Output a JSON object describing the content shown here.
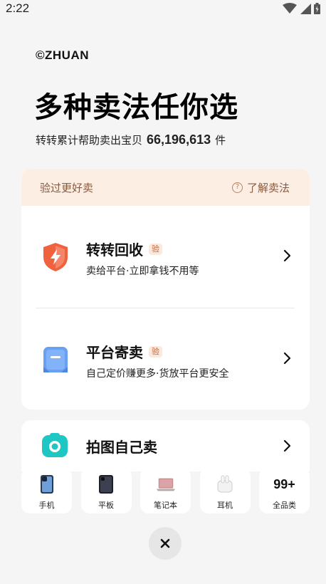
{
  "status_bar": {
    "time": "2:22",
    "icons": [
      "wifi-icon",
      "signal-icon",
      "battery-icon"
    ]
  },
  "brand": "©ZHUAN",
  "headline": "多种卖法任你选",
  "subline": {
    "prefix": "转转累计帮助卖出宝贝",
    "count": "66,196,613",
    "suffix": "件"
  },
  "card_header": {
    "left": "验过更好卖",
    "right": "了解卖法",
    "right_icon": "question-circle-icon"
  },
  "options": [
    {
      "title": "转转回收",
      "badge": "验",
      "desc": "卖给平台·立即拿钱不用等",
      "icon": "shield-lightning-icon"
    },
    {
      "title": "平台寄卖",
      "badge": "验",
      "desc": "自己定价赚更多·货放平台更安全",
      "icon": "box-icon"
    }
  ],
  "photo_sell": {
    "title": "拍图自己卖",
    "icon": "camera-icon"
  },
  "categories": [
    {
      "label": "手机",
      "icon": "phone-icon"
    },
    {
      "label": "平板",
      "icon": "tablet-icon"
    },
    {
      "label": "笔记本",
      "icon": "laptop-icon"
    },
    {
      "label": "耳机",
      "icon": "earphones-icon"
    },
    {
      "label": "全品类",
      "text": "99+"
    }
  ],
  "colors": {
    "accent_orange": "#f0623e",
    "badge_bg": "#fde8dc",
    "header_bg": "#fdeee4",
    "teal": "#1ec6c4",
    "blue": "#6aa0f2"
  }
}
